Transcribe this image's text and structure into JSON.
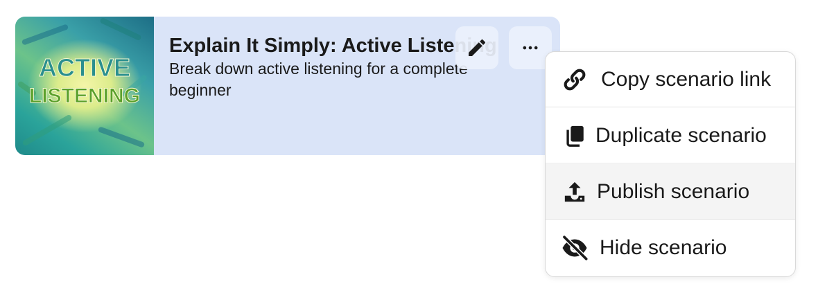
{
  "card": {
    "thumbnail_text_line1": "ACTIVE",
    "thumbnail_text_line2": "LISTENING",
    "title": "Explain It Simply: Active Listening",
    "description": "Break down active listening for a complete beginner",
    "edit_icon": "pencil-icon",
    "more_icon": "ellipsis-icon"
  },
  "menu": {
    "items": [
      {
        "label": "Copy scenario link",
        "icon": "link-icon",
        "active": false
      },
      {
        "label": "Duplicate scenario",
        "icon": "copy-icon",
        "active": false
      },
      {
        "label": "Publish scenario",
        "icon": "upload-icon",
        "active": true
      },
      {
        "label": "Hide scenario",
        "icon": "eye-slash-icon",
        "active": false
      }
    ]
  },
  "colors": {
    "card_background": "#dae4f8",
    "text": "#1a1a1a",
    "thumbnail_text_teal": "#2a8f8f",
    "thumbnail_text_green": "#5aa02c",
    "menu_hover": "#f4f4f4"
  }
}
